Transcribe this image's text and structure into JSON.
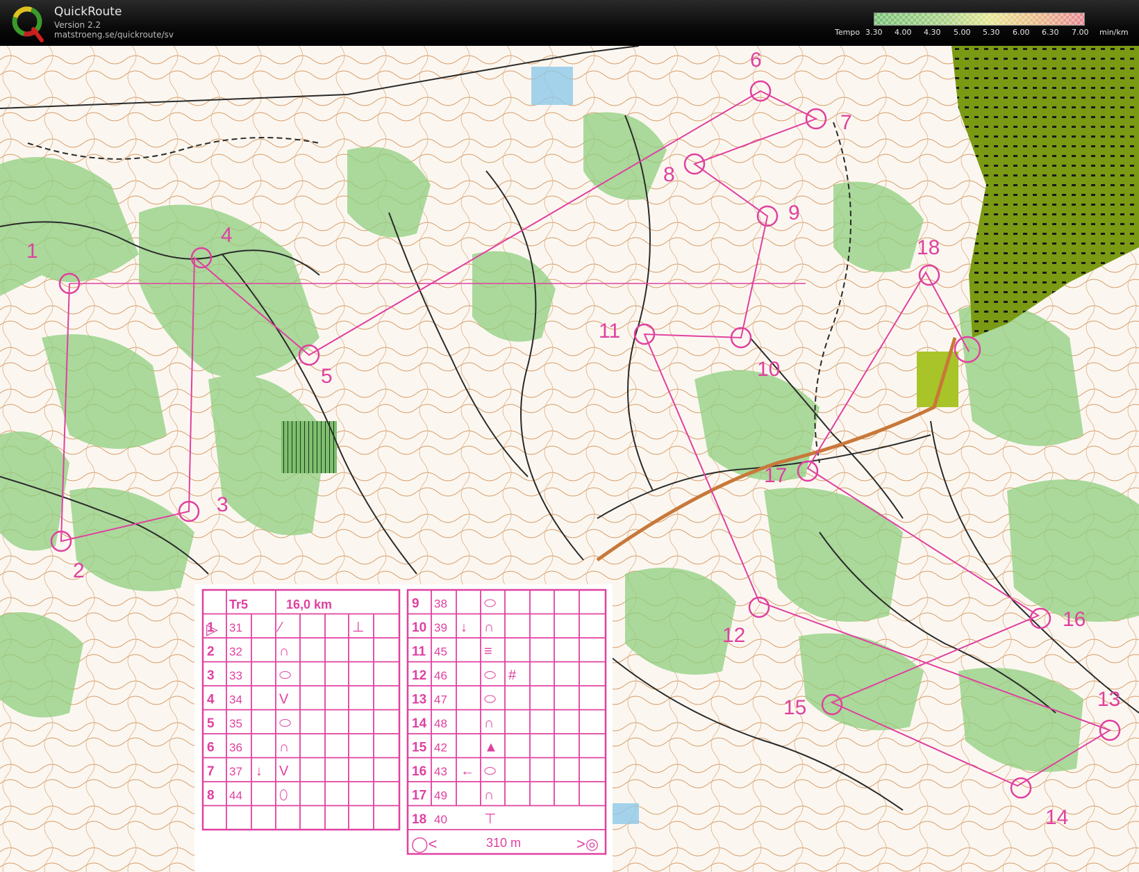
{
  "app": {
    "name": "QuickRoute",
    "version": "Version 2.2",
    "url": "matstroeng.se/quickroute/sv"
  },
  "tempo": {
    "label": "Tempo",
    "ticks": [
      "3.30",
      "4.00",
      "4.30",
      "5.00",
      "5.30",
      "6.00",
      "6.30",
      "7.00"
    ],
    "unit": "min/km"
  },
  "course": {
    "name": "Tr5",
    "length": "16,0 km",
    "finish_distance": "310 m",
    "controls": [
      {
        "n": "1",
        "code": "31",
        "dir": "",
        "sym": "/ (dashed)",
        "extra": "⊥"
      },
      {
        "n": "2",
        "code": "32",
        "dir": "",
        "sym": "∩",
        "extra": ""
      },
      {
        "n": "3",
        "code": "33",
        "dir": "",
        "sym": "⬭",
        "extra": ""
      },
      {
        "n": "4",
        "code": "34",
        "dir": "",
        "sym": "V",
        "extra": ""
      },
      {
        "n": "5",
        "code": "35",
        "dir": "",
        "sym": "⬭",
        "extra": ""
      },
      {
        "n": "6",
        "code": "36",
        "dir": "",
        "sym": "∩",
        "extra": ""
      },
      {
        "n": "7",
        "code": "37",
        "dir": "↓",
        "sym": "V",
        "extra": ""
      },
      {
        "n": "8",
        "code": "44",
        "dir": "",
        "sym": "⬯",
        "extra": ""
      },
      {
        "n": "9",
        "code": "38",
        "dir": "",
        "sym": "⬭",
        "extra": ""
      },
      {
        "n": "10",
        "code": "39",
        "dir": "↓",
        "sym": "∩",
        "extra": ""
      },
      {
        "n": "11",
        "code": "45",
        "dir": "",
        "sym": "≡",
        "extra": ""
      },
      {
        "n": "12",
        "code": "46",
        "dir": "",
        "sym": "⬭",
        "extra": "#"
      },
      {
        "n": "13",
        "code": "47",
        "dir": "",
        "sym": "⬭",
        "extra": ""
      },
      {
        "n": "14",
        "code": "48",
        "dir": "",
        "sym": "∩",
        "extra": ""
      },
      {
        "n": "15",
        "code": "42",
        "dir": "",
        "sym": "▲",
        "extra": ""
      },
      {
        "n": "16",
        "code": "43",
        "dir": "←",
        "sym": "⬭",
        "extra": ""
      },
      {
        "n": "17",
        "code": "49",
        "dir": "",
        "sym": "∩",
        "extra": ""
      },
      {
        "n": "18",
        "code": "40",
        "dir": "",
        "sym": "⊤",
        "extra": ""
      }
    ]
  },
  "map_labels": [
    "1",
    "2",
    "3",
    "4",
    "5",
    "6",
    "7",
    "8",
    "9",
    "10",
    "11",
    "12",
    "13",
    "14",
    "15",
    "16",
    "17",
    "18"
  ],
  "colors": {
    "course": "#e040a0",
    "forest_green": "#8fcf7f",
    "contour": "#c8783a",
    "urban": "#6f8f10"
  }
}
